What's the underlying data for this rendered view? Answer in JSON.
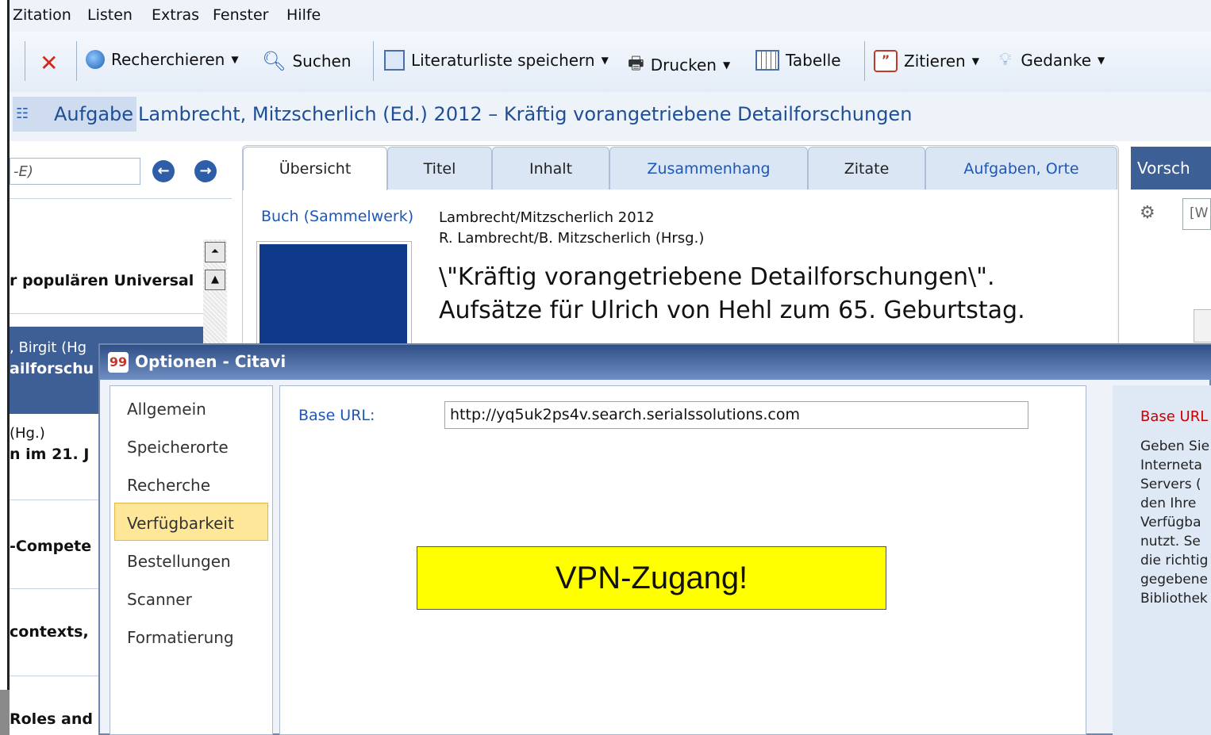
{
  "menu": [
    "Zitation",
    "Listen",
    "Extras",
    "Fenster",
    "Hilfe"
  ],
  "toolbar": {
    "research": "Recherchieren",
    "search": "Suchen",
    "save_list": "Literaturliste speichern",
    "print": "Drucken",
    "table": "Tabelle",
    "cite": "Zitieren",
    "thought": "Gedanke"
  },
  "reference_bar": {
    "tasks_label": "Aufgabe",
    "title": "Lambrecht, Mitzscherlich (Ed.) 2012 – Kräftig vorangetriebene Detailforschungen"
  },
  "left_panel": {
    "search_placeholder": "-E)",
    "items": [
      {
        "text": "r populären Universal",
        "bold": true
      },
      {
        "line1": ", Birgit (Hg",
        "line2": "ailforschu"
      },
      {
        "line1": " (Hg.)",
        "line2": "n im 21. J"
      },
      {
        "text": "-Compete",
        "bold": true
      },
      {
        "text": "contexts,",
        "bold": true
      },
      {
        "text": "Roles and",
        "bold": true
      }
    ]
  },
  "tabs": [
    "Übersicht",
    "Titel",
    "Inhalt",
    "Zusammenhang",
    "Zitate",
    "Aufgaben, Orte"
  ],
  "reference": {
    "type": "Buch (Sammelwerk)",
    "short": "Lambrecht/Mitzscherlich 2012",
    "editors": "R. Lambrecht/B. Mitzscherlich (Hrsg.)",
    "title_line1": "\\\"Kräftig vorangetriebene Detailforschungen\\\".",
    "title_line2": "Aufsätze für Ulrich von Hehl zum 65. Geburtstag."
  },
  "right_panel": {
    "tab": "Vorsch",
    "field": "[W"
  },
  "dialog": {
    "title": "Optionen - Citavi",
    "nav": [
      "Allgemein",
      "Speicherorte",
      "Recherche",
      "Verfügbarkeit",
      "Bestellungen",
      "Scanner",
      "Formatierung"
    ],
    "selected": "Verfügbarkeit",
    "base_url_label": "Base URL:",
    "base_url_value": "http://yq5uk2ps4v.search.serialssolutions.com",
    "callout": "VPN-Zugang!",
    "help_title": "Base URL",
    "help_lines": [
      "Geben Sie",
      "Interneta",
      "Servers (",
      "den Ihre",
      "Verfügba",
      "nutzt. Se",
      "die richtig",
      "gegebene",
      "Bibliothek"
    ]
  },
  "colors": {
    "accent": "#1d57b8",
    "dialog_title": "#2f4f86",
    "selection": "#ffe79a",
    "callout": "#ffff00",
    "help_title": "#cc0000"
  }
}
